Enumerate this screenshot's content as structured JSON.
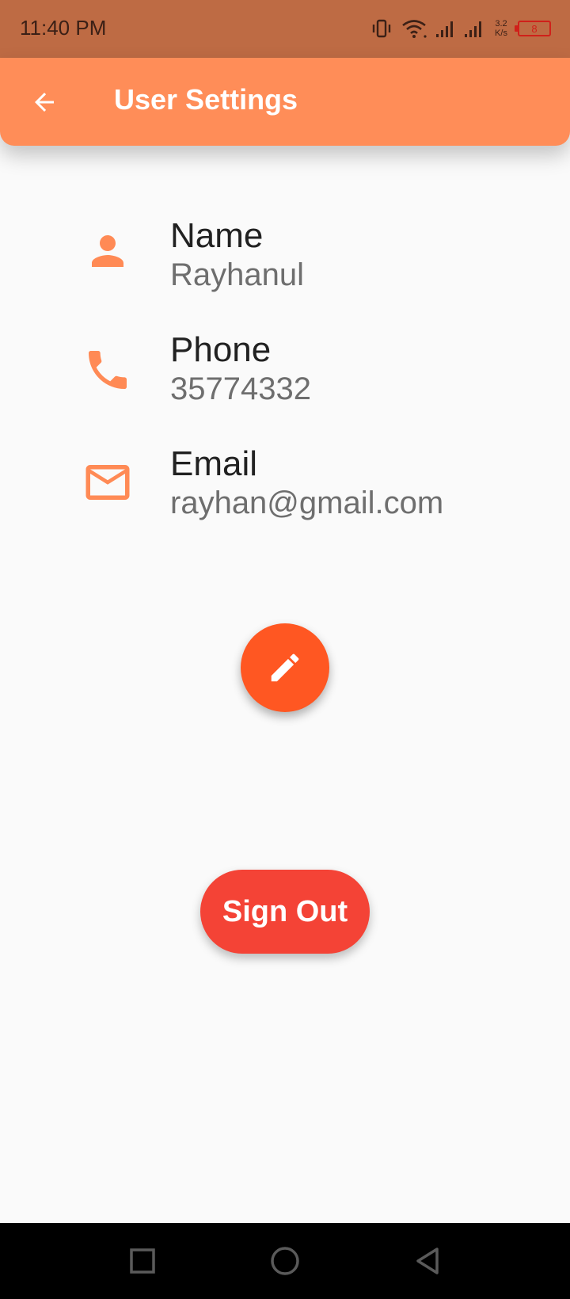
{
  "status_bar": {
    "time": "11:40 PM",
    "net_speed_value": "3.2",
    "net_speed_unit": "K/s",
    "battery_level": "8"
  },
  "app_bar": {
    "title": "User Settings",
    "back_icon": "arrow-back-icon"
  },
  "profile": {
    "name": {
      "label": "Name",
      "value": "Rayhanul",
      "icon": "person-icon"
    },
    "phone": {
      "label": "Phone",
      "value": "35774332",
      "icon": "phone-icon"
    },
    "email": {
      "label": "Email",
      "value": "rayhan@gmail.com",
      "icon": "mail-icon"
    }
  },
  "actions": {
    "edit_icon": "edit-pencil-icon",
    "sign_out_label": "Sign Out"
  },
  "colors": {
    "status_bar": "#be6b44",
    "app_bar": "#ff8d58",
    "icon_accent": "#ff8a55",
    "fab": "#ff5722",
    "sign_out": "#f44336"
  }
}
